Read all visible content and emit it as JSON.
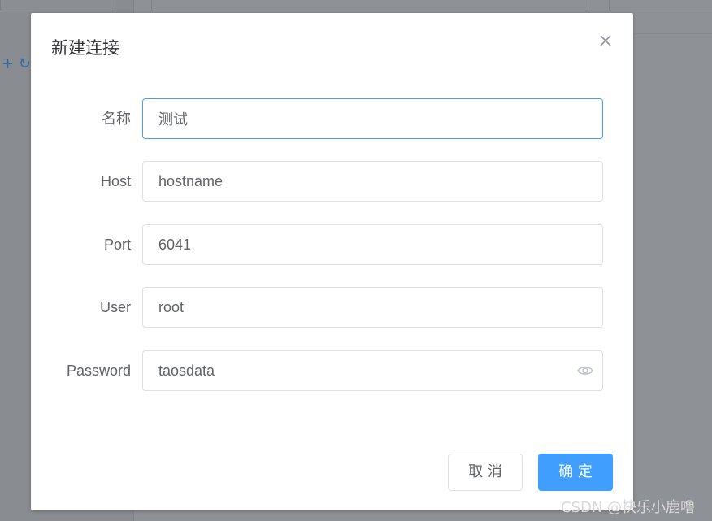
{
  "background": {
    "toolbar_icons": "+ ↻"
  },
  "dialog": {
    "title": "新建连接",
    "fields": [
      {
        "label": "名称",
        "value": "测试"
      },
      {
        "label": "Host",
        "value": "hostname"
      },
      {
        "label": "Port",
        "value": "6041"
      },
      {
        "label": "User",
        "value": "root"
      },
      {
        "label": "Password",
        "value": "taosdata"
      }
    ],
    "cancel_label": "取 消",
    "confirm_label": "确 定",
    "close_icon": "close-icon",
    "password_toggle_icon": "eye-icon"
  },
  "colors": {
    "primary": "#409eff",
    "overlay": "#8e9195",
    "border": "#dcdfe6",
    "text": "#606266"
  },
  "watermark": "CSDN @快乐小鹿噜"
}
